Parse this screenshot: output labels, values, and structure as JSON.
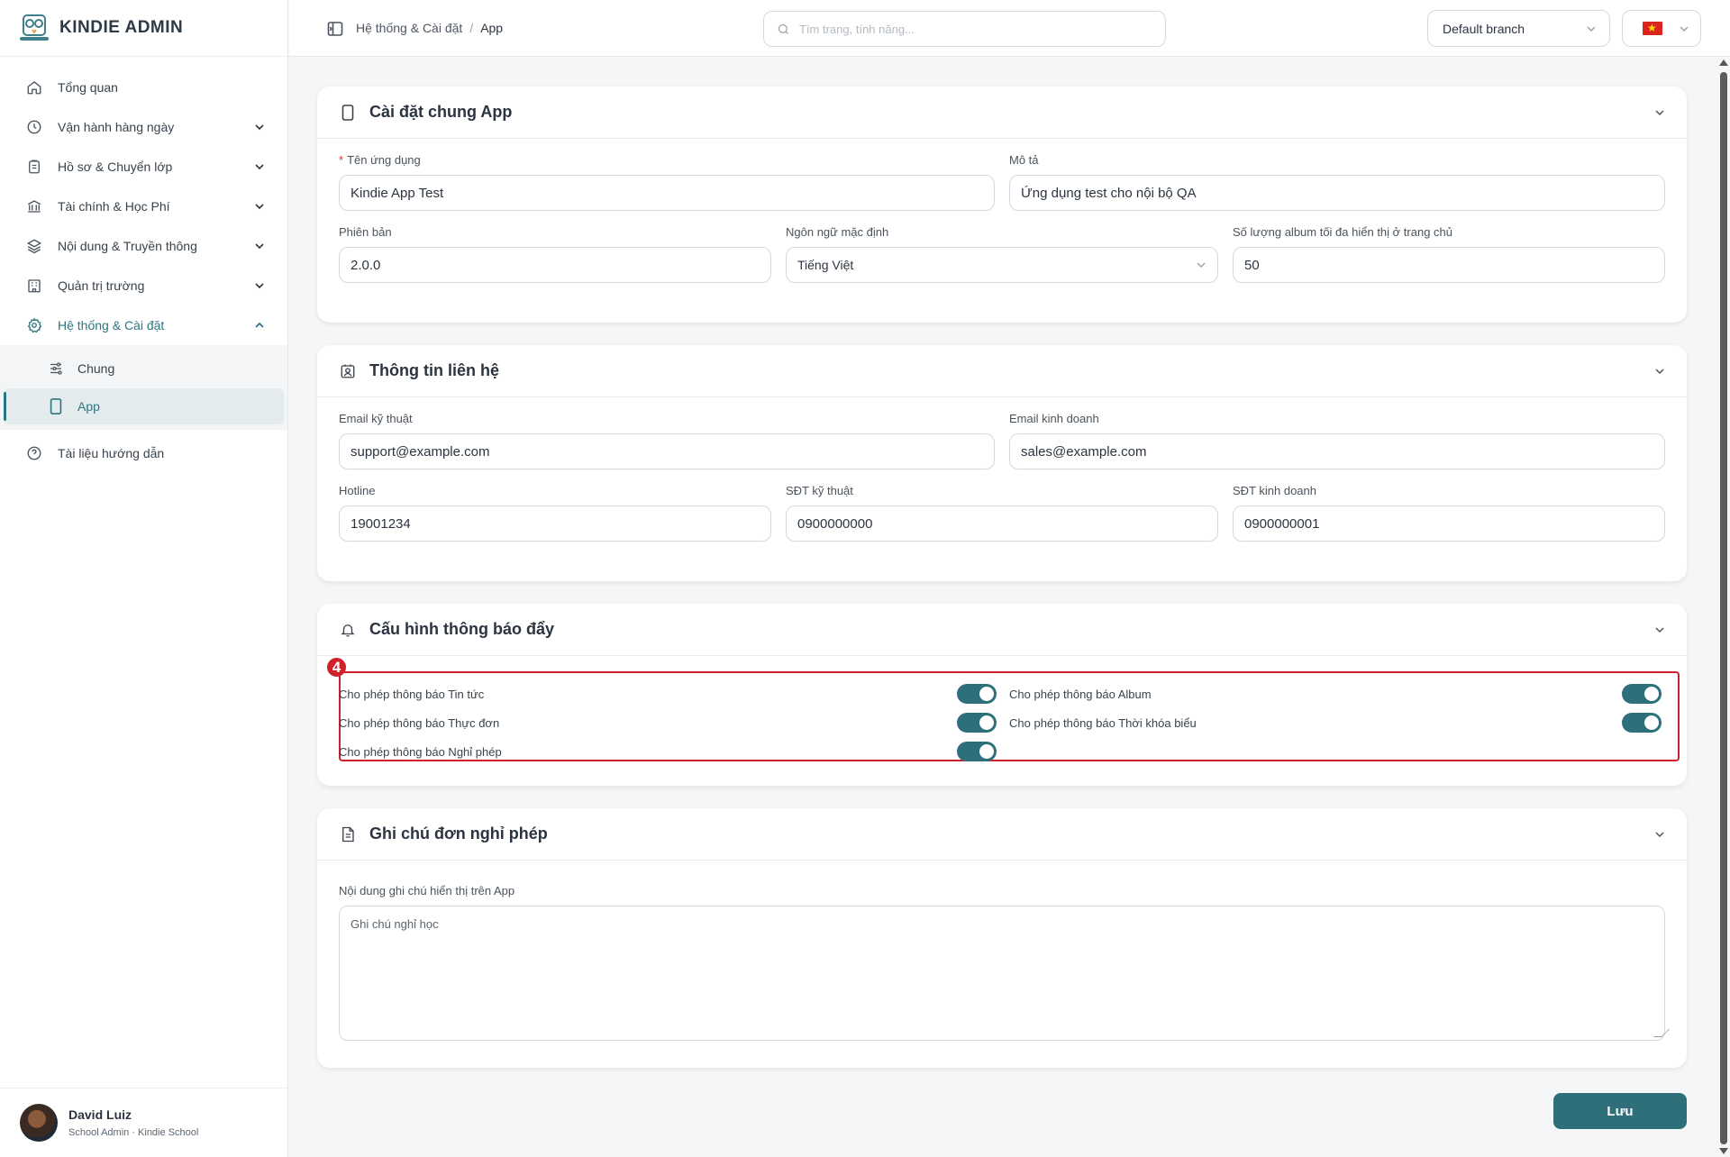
{
  "brand": {
    "name": "KINDIE ADMIN",
    "logo_icon": "owl-logo"
  },
  "sidebar": {
    "items": [
      {
        "label": "Tổng quan",
        "icon": "home-icon",
        "expandable": false
      },
      {
        "label": "Vận hành hàng ngày",
        "icon": "clock-icon",
        "expandable": true
      },
      {
        "label": "Hồ sơ & Chuyển lớp",
        "icon": "clipboard-icon",
        "expandable": true
      },
      {
        "label": "Tài chính & Học Phí",
        "icon": "bank-icon",
        "expandable": true
      },
      {
        "label": "Nội dung & Truyền thông",
        "icon": "layers-icon",
        "expandable": true
      },
      {
        "label": "Quản trị trường",
        "icon": "building-icon",
        "expandable": true
      },
      {
        "label": "Hệ thống & Cài đặt",
        "icon": "gear-icon",
        "expandable": true,
        "expanded": true
      }
    ],
    "sub_items": [
      {
        "label": "Chung",
        "icon": "sliders-icon"
      },
      {
        "label": "App",
        "icon": "phone-icon",
        "active": true
      }
    ],
    "help": {
      "label": "Tài liệu hướng dẫn",
      "icon": "help-circle-icon"
    }
  },
  "user": {
    "name": "David Luiz",
    "role": "School Admin · Kindie School"
  },
  "topbar": {
    "breadcrumb": [
      "Hệ thống & Cài đặt",
      "App"
    ],
    "breadcrumb_sep": "/",
    "search_placeholder": "Tìm trang, tính năng...",
    "branch": "Default branch",
    "language_flag": "vietnam-flag"
  },
  "general": {
    "title": "Cài đặt chung App",
    "app_name_label": "Tên ứng dụng",
    "app_name_value": "Kindie App Test",
    "desc_label": "Mô tả",
    "desc_value": "Ứng dụng test cho nội bộ QA",
    "version_label": "Phiên bản",
    "version_value": "2.0.0",
    "lang_label": "Ngôn ngữ mặc định",
    "lang_value": "Tiếng Việt",
    "album_label": "Số lượng album tối đa hiển thị ở trang chủ",
    "album_value": "50"
  },
  "contact": {
    "title": "Thông tin liên hệ",
    "tech_email_label": "Email kỹ thuật",
    "tech_email_value": "support@example.com",
    "sales_email_label": "Email kinh doanh",
    "sales_email_value": "sales@example.com",
    "hotline_label": "Hotline",
    "hotline_value": "19001234",
    "tech_phone_label": "SĐT kỹ thuật",
    "tech_phone_value": "0900000000",
    "sales_phone_label": "SĐT kinh doanh",
    "sales_phone_value": "0900000001"
  },
  "push": {
    "title": "Cấu hình thông báo đẩy",
    "annotation_badge": "4",
    "toggles": [
      {
        "label": "Cho phép thông báo Tin tức",
        "on": true
      },
      {
        "label": "Cho phép thông báo Album",
        "on": true
      },
      {
        "label": "Cho phép thông báo Thực đơn",
        "on": true
      },
      {
        "label": "Cho phép thông báo Thời khóa biểu",
        "on": true
      },
      {
        "label": "Cho phép thông báo Nghỉ phép",
        "on": true
      }
    ]
  },
  "leave_note": {
    "title": "Ghi chú đơn nghỉ phép",
    "content_label": "Nội dung ghi chú hiển thị trên App",
    "content_value": "Ghi chú nghỉ học"
  },
  "actions": {
    "save_label": "Lưu"
  },
  "colors": {
    "accent": "#2d6f7b",
    "highlight_box": "#d0212b"
  }
}
